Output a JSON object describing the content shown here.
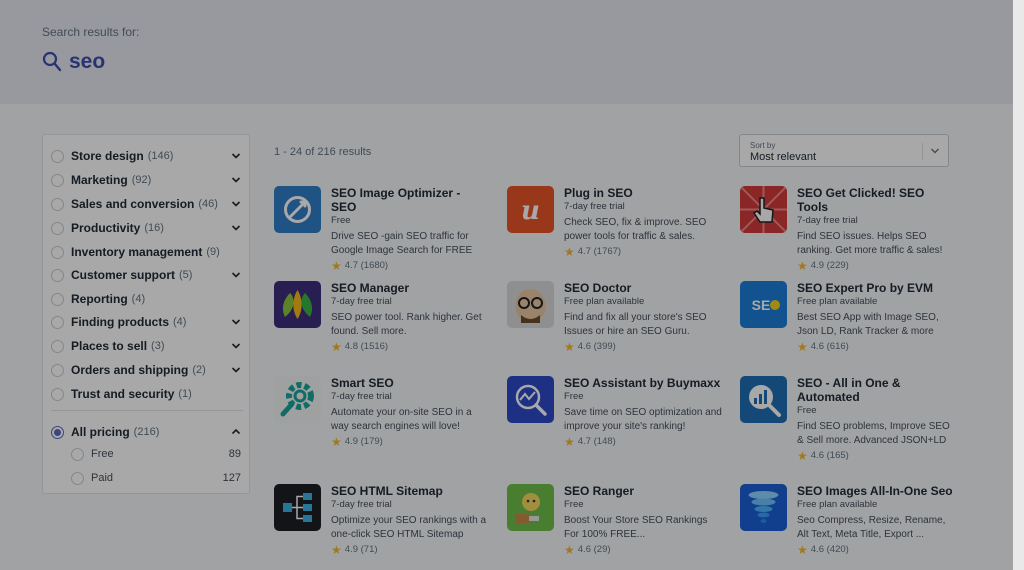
{
  "search": {
    "label": "Search results for:",
    "query": "seo"
  },
  "sidebar": {
    "categories": [
      {
        "label": "Store design",
        "count": "(146)",
        "chevron": true
      },
      {
        "label": "Marketing",
        "count": "(92)",
        "chevron": true
      },
      {
        "label": "Sales and conversion",
        "count": "(46)",
        "chevron": true
      },
      {
        "label": "Productivity",
        "count": "(16)",
        "chevron": true
      },
      {
        "label": "Inventory management",
        "count": "(9)",
        "chevron": false
      },
      {
        "label": "Customer support",
        "count": "(5)",
        "chevron": true
      },
      {
        "label": "Reporting",
        "count": "(4)",
        "chevron": false
      },
      {
        "label": "Finding products",
        "count": "(4)",
        "chevron": true
      },
      {
        "label": "Places to sell",
        "count": "(3)",
        "chevron": true
      },
      {
        "label": "Orders and shipping",
        "count": "(2)",
        "chevron": true
      },
      {
        "label": "Trust and security",
        "count": "(1)",
        "chevron": false
      }
    ],
    "pricing": {
      "label": "All pricing",
      "count": "(216)",
      "options": [
        {
          "label": "Free",
          "count": "89"
        },
        {
          "label": "Paid",
          "count": "127"
        }
      ]
    }
  },
  "results": {
    "count_text": "1 - 24 of 216 results"
  },
  "sort": {
    "label": "Sort by",
    "value": "Most relevant"
  },
  "apps": [
    {
      "name": "SEO Image Optimizer - SEO",
      "pricing": "Free",
      "desc": "Drive SEO -gain SEO traffic for Google Image Search for FREE",
      "rating": "4.7",
      "reviews": "(1680)",
      "icon": "rocket-icon",
      "color": "#2f7fc9"
    },
    {
      "name": "Plug in SEO",
      "pricing": "7-day free trial",
      "desc": "Check SEO, fix & improve. SEO power tools for traffic & sales.",
      "rating": "4.7",
      "reviews": "(1767)",
      "icon": "letter-u-icon",
      "color": "#e8542a"
    },
    {
      "name": "SEO Get Clicked! SEO Tools",
      "pricing": "7-day free trial",
      "desc": "Find SEO issues. Helps SEO ranking. Get more traffic & sales!",
      "rating": "4.9",
      "reviews": "(229)",
      "icon": "hand-cursor-icon",
      "color": "#d23b3b"
    },
    {
      "name": "SEO Manager",
      "pricing": "7-day free trial",
      "desc": "SEO power tool. Rank higher. Get found. Sell more.",
      "rating": "4.8",
      "reviews": "(1516)",
      "icon": "leaves-icon",
      "color": "#3d2e7c"
    },
    {
      "name": "SEO Doctor",
      "pricing": "Free plan available",
      "desc": "Find and fix all your store's SEO Issues or hire an SEO Guru.",
      "rating": "4.6",
      "reviews": "(399)",
      "icon": "doctor-face-icon",
      "color": "#d9d9d9"
    },
    {
      "name": "SEO Expert Pro by EVM",
      "pricing": "Free plan available",
      "desc": "Best SEO App with Image SEO, Json LD, Rank Tracker & more",
      "rating": "4.6",
      "reviews": "(616)",
      "icon": "seo-text-icon",
      "color": "#1c7fd9"
    },
    {
      "name": "Smart SEO",
      "pricing": "7-day free trial",
      "desc": "Automate your on-site SEO in a way search engines will love!",
      "rating": "4.9",
      "reviews": "(179)",
      "icon": "gear-search-icon",
      "color": "#f2f4f5"
    },
    {
      "name": "SEO Assistant by Buymaxx",
      "pricing": "Free",
      "desc": "Save time on SEO optimization and improve your site's ranking!",
      "rating": "4.7",
      "reviews": "(148)",
      "icon": "magnifier-chart-icon",
      "color": "#2d49c8"
    },
    {
      "name": "SEO - All in One & Automated",
      "pricing": "Free",
      "desc": "Find SEO problems, Improve SEO & Sell more. Advanced JSON+LD",
      "rating": "4.6",
      "reviews": "(165)",
      "icon": "magnifier-bars-icon",
      "color": "#1f6fb5"
    },
    {
      "name": "SEO HTML Sitemap",
      "pricing": "7-day free trial",
      "desc": "Optimize your SEO rankings with a one-click SEO HTML Sitemap",
      "rating": "4.9",
      "reviews": "(71)",
      "icon": "sitemap-icon",
      "color": "#1c1f24"
    },
    {
      "name": "SEO Ranger",
      "pricing": "Free",
      "desc": "Boost Your Store SEO Rankings For 100% FREE...",
      "rating": "4.6",
      "reviews": "(29)",
      "icon": "ranger-icon",
      "color": "#6fbf4a"
    },
    {
      "name": "SEO Images All-In-One Seo",
      "pricing": "Free plan available",
      "desc": "Seo Compress, Resize, Rename, Alt Text, Meta Title, Export ...",
      "rating": "4.6",
      "reviews": "(420)",
      "icon": "tornado-icon",
      "color": "#1b5fd6"
    }
  ]
}
